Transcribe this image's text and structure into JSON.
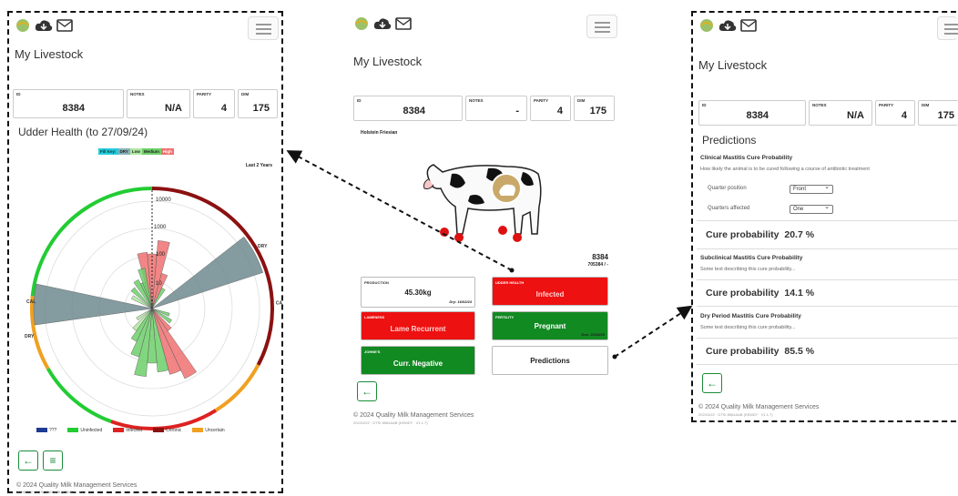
{
  "app_title": "My Livestock",
  "animal": {
    "id_label": "ID",
    "id": "8384",
    "notes_label": "NOTES",
    "notes_na": "N/A",
    "notes_dash": "-",
    "parity_label": "PARITY",
    "parity": "4",
    "dim_label": "DIM",
    "dim": "175",
    "breed": "Holstein Friesian",
    "tag": "8384",
    "tag_sub": "705384 / -"
  },
  "udder": {
    "title": "Udder Health (to 27/09/24)",
    "fill_key": [
      "Fill Key:",
      "DRY",
      "Low",
      "Medium",
      "High"
    ],
    "range": "Last 2 Years",
    "scale_ticks": [
      "10000",
      "1000",
      "100",
      "10"
    ],
    "ring_labels": [
      "DRY",
      "CAL",
      "CAL",
      "DRY"
    ],
    "legend": [
      {
        "label": "???",
        "color": "#1f3a93"
      },
      {
        "label": "Uninfected",
        "color": "#22cc33"
      },
      {
        "label": "Infected",
        "color": "#dd2222"
      },
      {
        "label": "Chronic",
        "color": "#8b1111"
      },
      {
        "label": "Uncertain",
        "color": "#f0a020"
      }
    ]
  },
  "tiles": {
    "production_label": "PRODUCTION",
    "production": "45.30kg",
    "production_sub": "Dry: 16/02/24",
    "udder_label": "UDDER HEALTH",
    "udder": "Infected",
    "lameness_label": "LAMENESS",
    "lameness": "Lame Recurrent",
    "fertility_label": "FERTILITY",
    "fertility": "Pregnant",
    "fertility_sub": "Due: 22/04/25",
    "johnes_label": "JOHNE'S",
    "johnes": "Curr. Negative",
    "predictions": "Predictions"
  },
  "predictions": {
    "title": "Predictions",
    "clinical_title": "Clinical Mastitis Cure Probability",
    "clinical_desc": "How likely the animal is to be cured following a course of antibiotic treatment",
    "quarter_position_label": "Quarter position",
    "quarter_position": "Front",
    "quarters_affected_label": "Quarters affected",
    "quarters_affected": "One",
    "cure_label": "Cure probability",
    "clinical_value": "20.7 %",
    "subclinical_title": "Subclinical Mastitis Cure Probability",
    "subclinical_desc": "Some text describing this cure probability...",
    "subclinical_value": "14.1 %",
    "dry_title": "Dry Period Mastitis Cure Probability",
    "dry_desc": "Some text describing this cure probability...",
    "dry_value": "85.5 %"
  },
  "footer": {
    "copyright": "© 2024 Quality Milk Management Services",
    "build": "20241022 · DTSI 8564AAB (KEMDY · V1.1.7)"
  },
  "colors": {
    "green": "#1a8c3a",
    "red": "#ee1111",
    "navy": "#1f3a93"
  }
}
